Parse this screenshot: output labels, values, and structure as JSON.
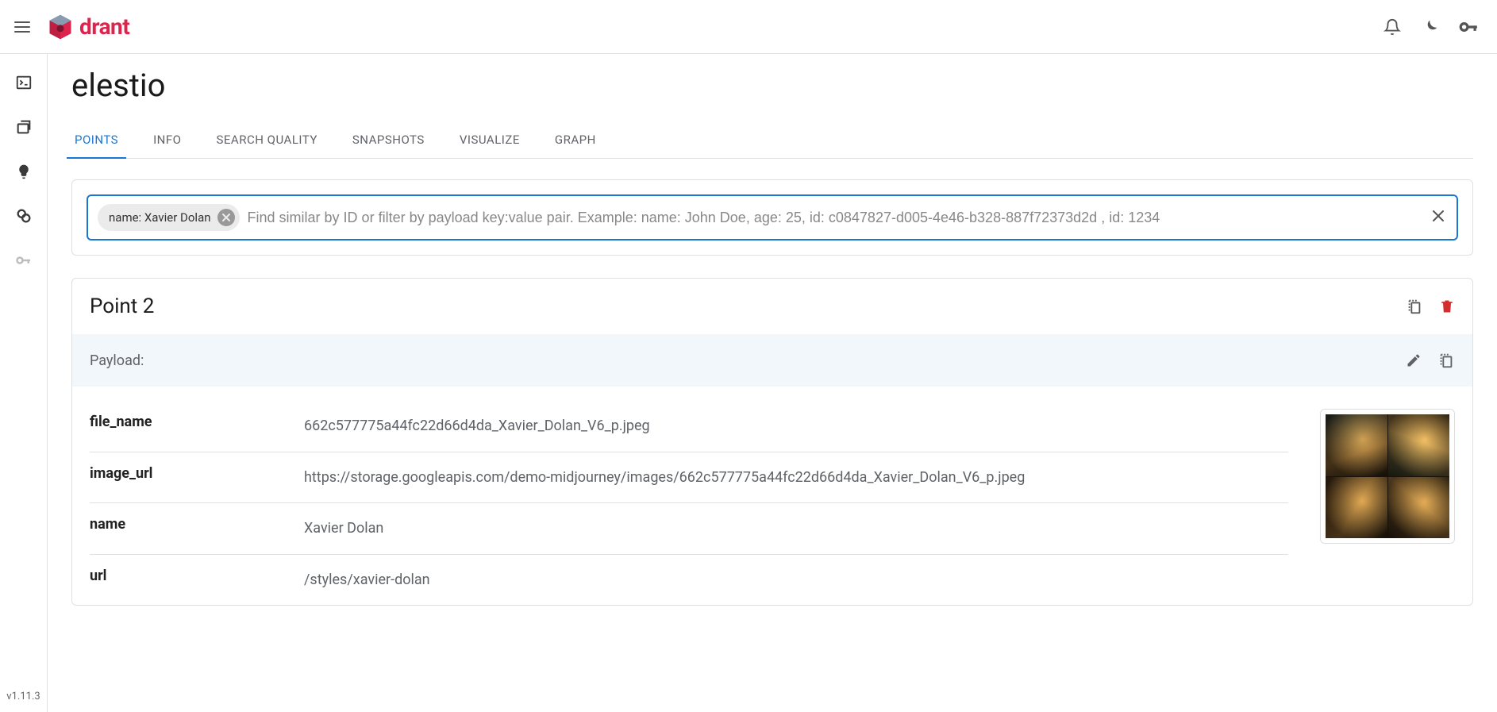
{
  "brand": "drant",
  "version": "v1.11.3",
  "page_title": "elestio",
  "tabs": [
    {
      "label": "POINTS",
      "active": true
    },
    {
      "label": "INFO",
      "active": false
    },
    {
      "label": "SEARCH QUALITY",
      "active": false
    },
    {
      "label": "SNAPSHOTS",
      "active": false
    },
    {
      "label": "VISUALIZE",
      "active": false
    },
    {
      "label": "GRAPH",
      "active": false
    }
  ],
  "search": {
    "chip": "name: Xavier Dolan",
    "placeholder": "Find similar by ID or filter by payload key:value pair. Example: name: John Doe, age: 25, id: c0847827-d005-4e46-b328-887f72373d2d , id: 1234"
  },
  "point": {
    "title": "Point 2",
    "payload_label": "Payload:",
    "rows": [
      {
        "key": "file_name",
        "value": "662c577775a44fc22d66d4da_Xavier_Dolan_V6_p.jpeg"
      },
      {
        "key": "image_url",
        "value": "https://storage.googleapis.com/demo-midjourney/images/662c577775a44fc22d66d4da_Xavier_Dolan_V6_p.jpeg"
      },
      {
        "key": "name",
        "value": "Xavier Dolan"
      },
      {
        "key": "url",
        "value": "/styles/xavier-dolan"
      }
    ]
  }
}
